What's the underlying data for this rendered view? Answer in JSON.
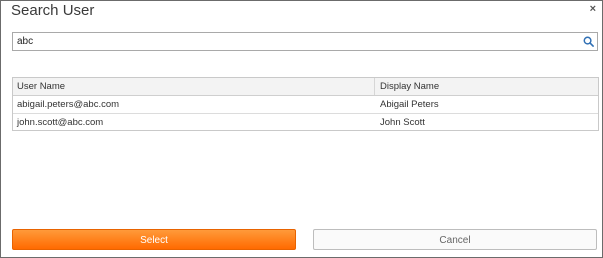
{
  "dialog": {
    "title": "Search User",
    "close_glyph": "×"
  },
  "search": {
    "value": "abc",
    "icon": "magnifier"
  },
  "table": {
    "columns": [
      "User Name",
      "Display Name"
    ],
    "rows": [
      [
        "abigail.peters@abc.com",
        "Abigail Peters"
      ],
      [
        "john.scott@abc.com",
        "John Scott"
      ]
    ]
  },
  "buttons": {
    "select_label": "Select",
    "cancel_label": "Cancel"
  },
  "colors": {
    "accent": "#ff7a10",
    "search_icon": "#2f6fb4"
  }
}
